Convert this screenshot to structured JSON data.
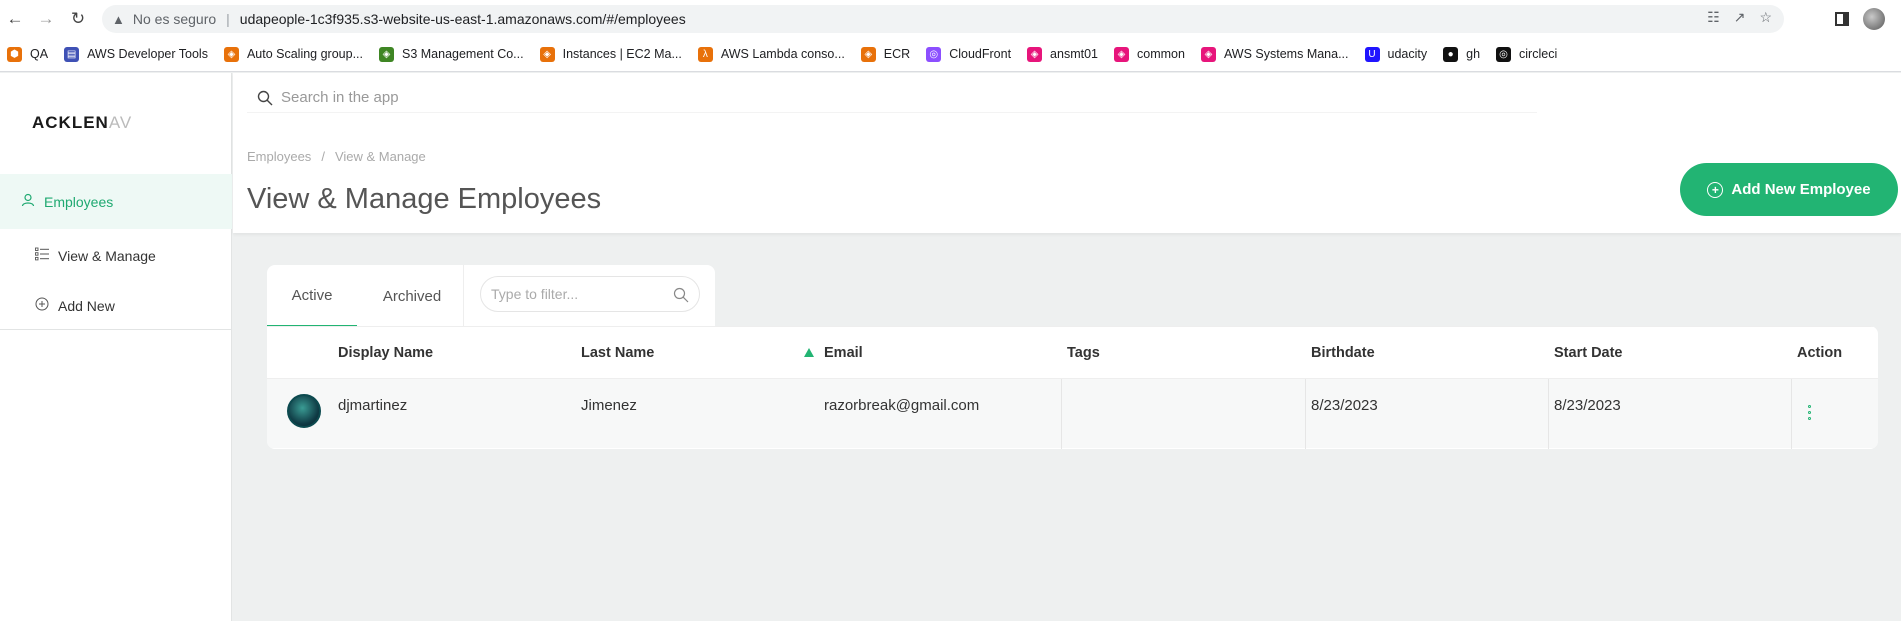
{
  "browser": {
    "security_label": "No es seguro",
    "url": "udapeople-1c3f935.s3-website-us-east-1.amazonaws.com/#/employees",
    "bookmarks": [
      {
        "label": "QA",
        "icon": "cube-icon",
        "color": "#e8710a"
      },
      {
        "label": "AWS Developer Tools",
        "icon": "aws-dev-tools-icon",
        "color": "#3f51b5"
      },
      {
        "label": "Auto Scaling group...",
        "icon": "aws-ec2-icon",
        "color": "#e8710a"
      },
      {
        "label": "S3 Management Co...",
        "icon": "aws-s3-icon",
        "color": "#3f8624"
      },
      {
        "label": "Instances | EC2 Ma...",
        "icon": "aws-ec2-icon",
        "color": "#e8710a"
      },
      {
        "label": "AWS Lambda conso...",
        "icon": "aws-lambda-icon",
        "color": "#e8710a"
      },
      {
        "label": "ECR",
        "icon": "aws-ecr-icon",
        "color": "#e8710a"
      },
      {
        "label": "CloudFront",
        "icon": "aws-cloudfront-icon",
        "color": "#8c4fff"
      },
      {
        "label": "ansmt01",
        "icon": "aws-systems-manager-icon",
        "color": "#e7157b"
      },
      {
        "label": "common",
        "icon": "aws-systems-manager-icon",
        "color": "#e7157b"
      },
      {
        "label": "AWS Systems Mana...",
        "icon": "aws-systems-manager-icon",
        "color": "#e7157b"
      },
      {
        "label": "udacity",
        "icon": "udacity-icon",
        "color": "#2015ff"
      },
      {
        "label": "gh",
        "icon": "github-icon",
        "color": "#111111"
      },
      {
        "label": "circleci",
        "icon": "circleci-icon",
        "color": "#111111"
      }
    ]
  },
  "sidebar": {
    "logo_main": "ACKLEN",
    "logo_fade": "AV",
    "items": [
      {
        "label": "Employees",
        "icon": "user-icon"
      },
      {
        "label": "View & Manage",
        "icon": "list-icon"
      },
      {
        "label": "Add New",
        "icon": "plus-circle-icon"
      }
    ]
  },
  "header": {
    "search_placeholder": "Search in the app",
    "breadcrumb": [
      "Employees",
      "View & Manage"
    ],
    "breadcrumb_sep": "/",
    "title": "View & Manage Employees",
    "add_button_label": "Add New Employee"
  },
  "tabs": {
    "items": [
      "Active",
      "Archived"
    ],
    "active": "Active",
    "filter_placeholder": "Type to filter..."
  },
  "table": {
    "columns": [
      "Display Name",
      "Last Name",
      "Email",
      "Tags",
      "Birthdate",
      "Start Date",
      "Action"
    ],
    "sorted_column": "Email",
    "rows": [
      {
        "display_name": "djmartinez",
        "last_name": "Jimenez",
        "email": "razorbreak@gmail.com",
        "tags": "",
        "birthdate": "8/23/2023",
        "start_date": "8/23/2023"
      }
    ]
  },
  "colors": {
    "accent": "#22b473",
    "active_bg": "#eef9f5"
  }
}
